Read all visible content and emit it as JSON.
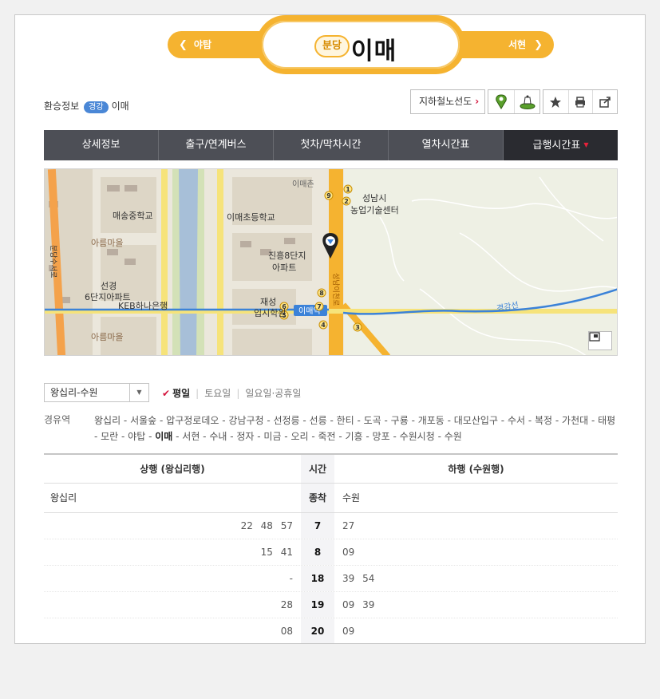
{
  "header": {
    "prev_station": "야탑",
    "next_station": "서현",
    "line_badge": "분당",
    "station_name": "이매",
    "line_color": "#f5b330"
  },
  "info": {
    "transfer_label": "환승정보",
    "transfer_line": "경강",
    "transfer_station": "이매",
    "route_map_button": "지하철노선도"
  },
  "tabs": [
    "상세정보",
    "출구/연계버스",
    "첫차/막차시간",
    "열차시간표",
    "급행시간표"
  ],
  "map": {
    "labels": {
      "school1": "매송중학교",
      "school2": "이매초등학교",
      "apt1": "아름마을",
      "apt2": "진흥8단지 아파트",
      "apt3": "선경 6단지아파트",
      "bank": "KEB하나은행",
      "academy": "재성 입시학원",
      "center": "성남시 농업기술센터",
      "village": "이매촌",
      "apt4": "아름마을",
      "line": "경강선",
      "station": "이매역",
      "road": "성남이천로",
      "road2": "분당수서로"
    },
    "exits": [
      "1",
      "2",
      "3",
      "4",
      "5",
      "6",
      "7",
      "8",
      "9"
    ]
  },
  "filter": {
    "direction": "왕십리-수원",
    "days": [
      "평일",
      "토요일",
      "일요일·공휴일"
    ]
  },
  "route": {
    "label": "경유역",
    "stations_before": "왕십리 - 서울숲 - 압구정로데오 - 강남구청 - 선정릉 - 선릉 - 한티 - 도곡 - 구룡 - 개포동 - 대모산입구 - 수서 - 복정 - 가천대 - 태평 - 모란 - 야탑 - ",
    "current": "이매",
    "stations_after": " - 서현 - 수내 - 정자 - 미금 - 오리 - 죽전 - 기흥 - 망포 - 수원시청 - 수원"
  },
  "timetable": {
    "head_up": "상행 (왕십리행)",
    "head_time": "시간",
    "head_down": "하행 (수원행)",
    "end_up": "왕십리",
    "end_label": "종착",
    "end_down": "수원",
    "rows": [
      {
        "up": "22 48 57",
        "hour": "7",
        "down": "27"
      },
      {
        "up": "15 41",
        "hour": "8",
        "down": "09"
      },
      {
        "up": "-",
        "hour": "18",
        "down": "39 54"
      },
      {
        "up": "28",
        "hour": "19",
        "down": "09 39"
      },
      {
        "up": "08",
        "hour": "20",
        "down": "09"
      }
    ]
  }
}
